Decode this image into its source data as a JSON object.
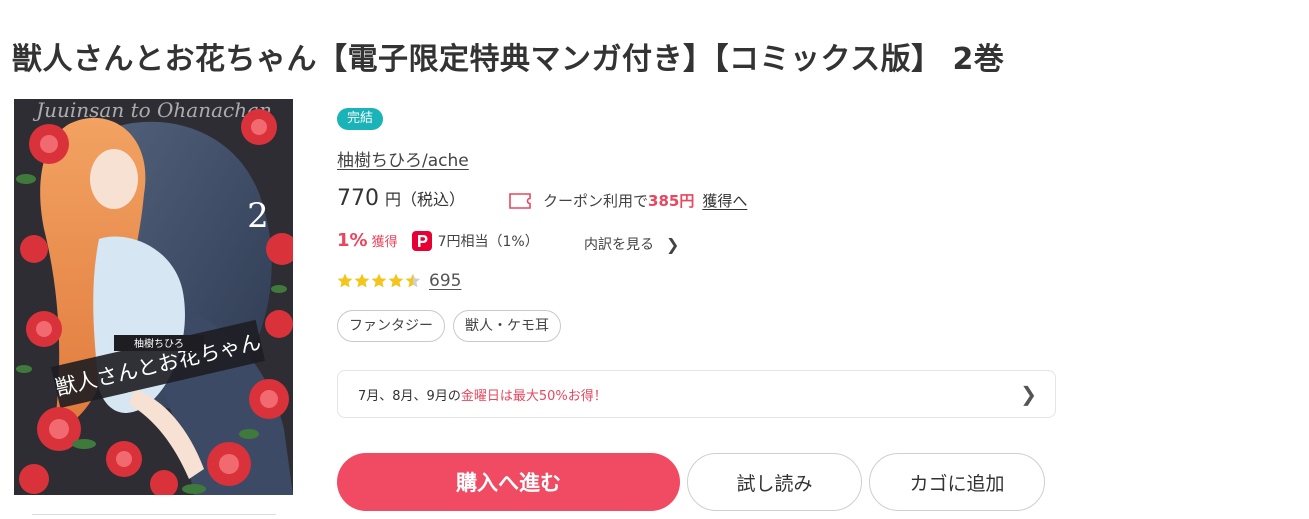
{
  "page": {
    "title": "獣人さんとお花ちゃん【電子限定特典マンガ付き】【コミックス版】 2巻"
  },
  "cover": {
    "image_alt": "獣人さんとお花ちゃん 2巻 表紙",
    "volume_number": "2",
    "title_text": "獣人さんとお花ちゃん",
    "author_text": "柚樹ちひろ",
    "logo_text": "Juuinsan to Ohanachan"
  },
  "product": {
    "status_badge": "完結",
    "author": "柚樹ちひろ/ache",
    "price": "770",
    "price_unit": "円（税込）",
    "coupon_prefix": "クーポン利用で",
    "coupon_amount": "385円",
    "coupon_link": "獲得へ",
    "points_percent": "1%",
    "points_label": "獲得",
    "points_equiv": "7円相当（1%）",
    "breakdown_link": "内訳を見る",
    "rating": 4.5,
    "review_count": "695",
    "tags": [
      "ファンタジー",
      "獣人・ケモ耳"
    ]
  },
  "campaign": {
    "prefix": "7月、8月、9月の",
    "highlight": "金曜日は最大50%お得！"
  },
  "actions": {
    "buy_label": "購入へ進む",
    "trial_label": "試し読み",
    "cart_label": "カゴに追加"
  },
  "colors": {
    "accent": "#f04b63",
    "badge": "#19b3b8",
    "star": "#f5c518"
  },
  "icons": {
    "coupon": "coupon-ticket-icon",
    "points": "paypay-point-icon",
    "chevron": "chevron-right-icon",
    "star": "star-icon"
  }
}
